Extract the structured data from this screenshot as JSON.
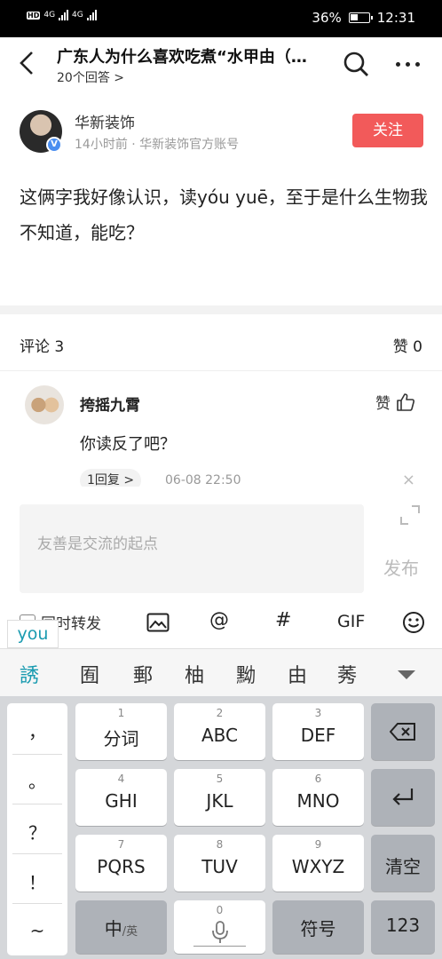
{
  "status": {
    "battery": "36%",
    "time": "12:31",
    "net1": "4G",
    "net2": "4G",
    "hd": "HD"
  },
  "nav": {
    "title": "广东人为什么喜欢吃煮“水甲由（…",
    "subtitle": "20个回答 >"
  },
  "author": {
    "name": "华新装饰",
    "meta": "14小时前 · 华新装饰官方账号",
    "follow_label": "关注",
    "badge": "V"
  },
  "answer": {
    "text": "这俩字我好像认识，读yóu yuē，至于是什么生物我不知道，能吃？"
  },
  "comment_bar": {
    "count_label": "评论 3",
    "like_label": "赞 0"
  },
  "comment": {
    "user": "挎摇九霄",
    "like_label": "赞",
    "text": "你读反了吧？",
    "reply_label": "1回复 >",
    "time": "06-08 22:50",
    "close": "×"
  },
  "composer": {
    "placeholder": "友善是交流的起点",
    "publish_label": "发布",
    "repost_label": "同时转发",
    "tools": {
      "at": "@",
      "hash": "#",
      "gif": "GIF"
    }
  },
  "ime": {
    "composing": "you",
    "candidates": [
      "誘",
      "囿",
      "郵",
      "柚",
      "黝",
      "由",
      "莠"
    ],
    "punct": [
      "，",
      "。",
      "？",
      "！",
      "~"
    ],
    "keys": {
      "k1": {
        "num": "1",
        "label": "分词"
      },
      "k2": {
        "num": "2",
        "label": "ABC"
      },
      "k3": {
        "num": "3",
        "label": "DEF"
      },
      "k4": {
        "num": "4",
        "label": "GHI"
      },
      "k5": {
        "num": "5",
        "label": "JKL"
      },
      "k6": {
        "num": "6",
        "label": "MNO"
      },
      "k7": {
        "num": "7",
        "label": "PQRS"
      },
      "k8": {
        "num": "8",
        "label": "TUV"
      },
      "k9": {
        "num": "9",
        "label": "WXYZ"
      },
      "k0": {
        "num": "0"
      },
      "clear": "清空",
      "lang_main": "中",
      "lang_sub": "/英",
      "symbol": "符号",
      "num": "123"
    }
  },
  "colors": {
    "accent": "#f25a5a",
    "ime_highlight": "#1a9bb0",
    "verified": "#4a8ef0"
  }
}
